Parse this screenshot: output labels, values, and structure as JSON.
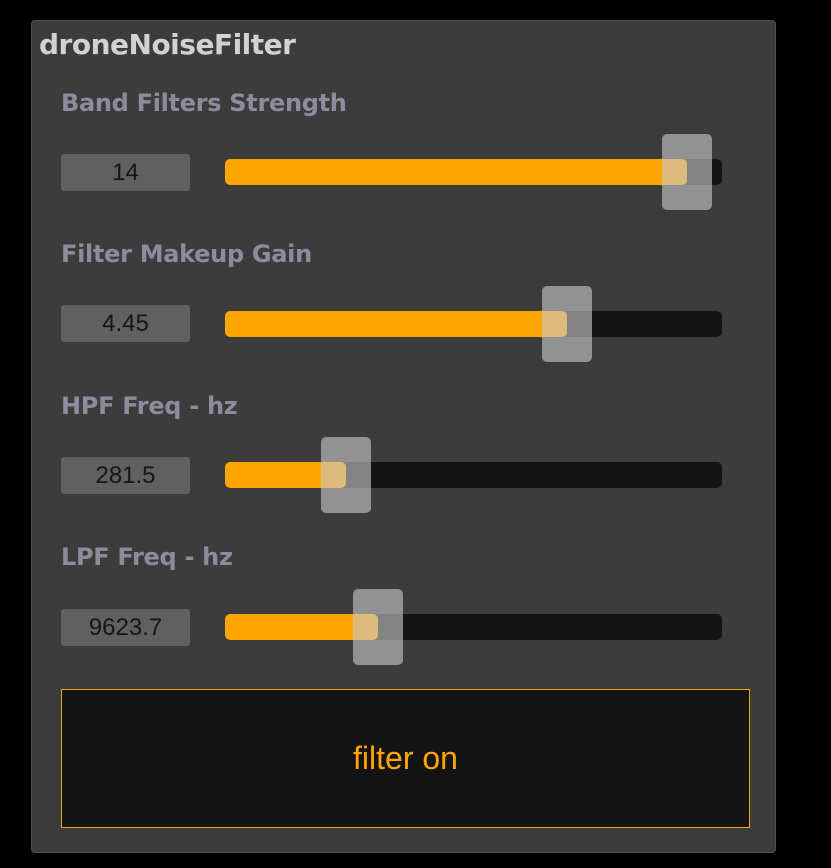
{
  "plugin": {
    "title": "droneNoiseFilter"
  },
  "params": [
    {
      "label": "Band Filters Strength",
      "value": "14",
      "fraction": 0.93
    },
    {
      "label": "Filter Makeup Gain",
      "value": "4.45",
      "fraction": 0.689
    },
    {
      "label": "HPF Freq - hz",
      "value": "281.5",
      "fraction": 0.243
    },
    {
      "label": "LPF Freq - hz",
      "value": "9623.7",
      "fraction": 0.308
    }
  ],
  "toggle": {
    "label": "filter on"
  },
  "colors": {
    "accent": "#ffa500",
    "panel": "#3c3c3c",
    "track": "#141414",
    "label": "#8f8b9e"
  }
}
